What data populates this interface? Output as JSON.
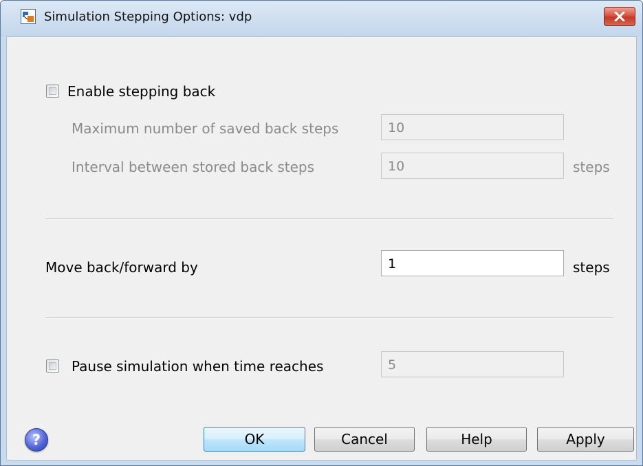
{
  "window": {
    "title": "Simulation Stepping Options: vdp",
    "app_icon": "simulink-icon",
    "close_icon": "close-icon"
  },
  "stepping_back": {
    "enable_label": "Enable stepping back",
    "enabled": false,
    "max_saved_label": "Maximum number of saved back steps",
    "max_saved_value": "10",
    "interval_label": "Interval between stored back steps",
    "interval_value": "10",
    "interval_unit": "steps"
  },
  "move": {
    "label": "Move back/forward by",
    "value": "1",
    "unit": "steps"
  },
  "pause": {
    "label": "Pause simulation when time reaches",
    "enabled": false,
    "value": "5"
  },
  "buttons": {
    "help_icon": "help-icon",
    "ok": "OK",
    "cancel": "Cancel",
    "help": "Help",
    "apply": "Apply"
  },
  "colors": {
    "title_bar": "#c9dcef",
    "close_button": "#c4392a",
    "default_button": "#3c7fb1"
  }
}
